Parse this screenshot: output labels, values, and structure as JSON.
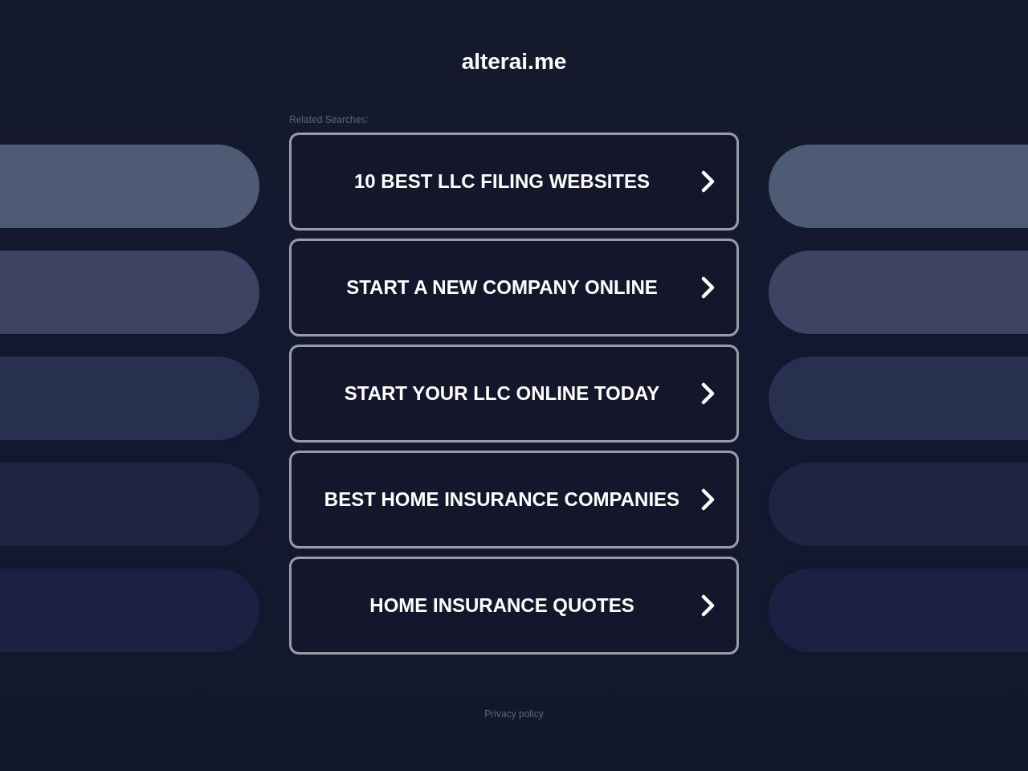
{
  "site_title": "alterai.me",
  "related_label": "Related Searches:",
  "links": [
    {
      "label": "10 BEST LLC FILING WEBSITES"
    },
    {
      "label": "START A NEW COMPANY ONLINE"
    },
    {
      "label": "START YOUR LLC ONLINE TODAY"
    },
    {
      "label": "BEST HOME INSURANCE COMPANIES"
    },
    {
      "label": "HOME INSURANCE QUOTES"
    }
  ],
  "footer_link": "Privacy policy"
}
